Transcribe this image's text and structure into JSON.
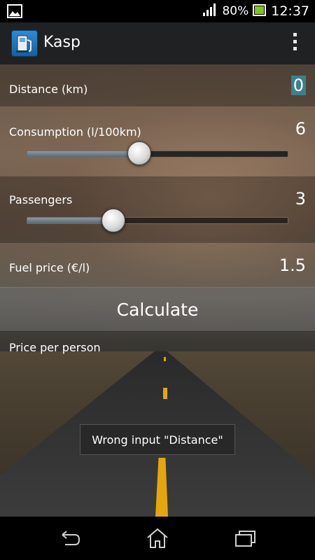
{
  "status_bar": {
    "battery_percent": "80%",
    "time": "12:37",
    "icons": [
      "image-notification-icon",
      "signal-icon",
      "battery-icon"
    ]
  },
  "action_bar": {
    "title": "Kasp",
    "app_icon": "fuel-pump-icon",
    "overflow_icon": "overflow-menu-icon"
  },
  "form": {
    "distance": {
      "label": "Distance (km)",
      "value": "0"
    },
    "consumption": {
      "label": "Consumption (l/100km)",
      "value": "6",
      "slider_fraction": 0.43
    },
    "passengers": {
      "label": "Passengers",
      "value": "3",
      "slider_fraction": 0.33
    },
    "fuel_price": {
      "label": "Fuel price (€/l)",
      "value": "1.5"
    }
  },
  "calculate_button": {
    "label": "Calculate"
  },
  "result": {
    "label": "Price per person"
  },
  "toast": {
    "message": "Wrong input \"Distance\""
  },
  "nav_bar": {
    "icons": [
      "back-icon",
      "home-icon",
      "recent-apps-icon"
    ]
  },
  "colors": {
    "selection": "#3e7f8f",
    "road_stripe": "#e5a60d"
  }
}
